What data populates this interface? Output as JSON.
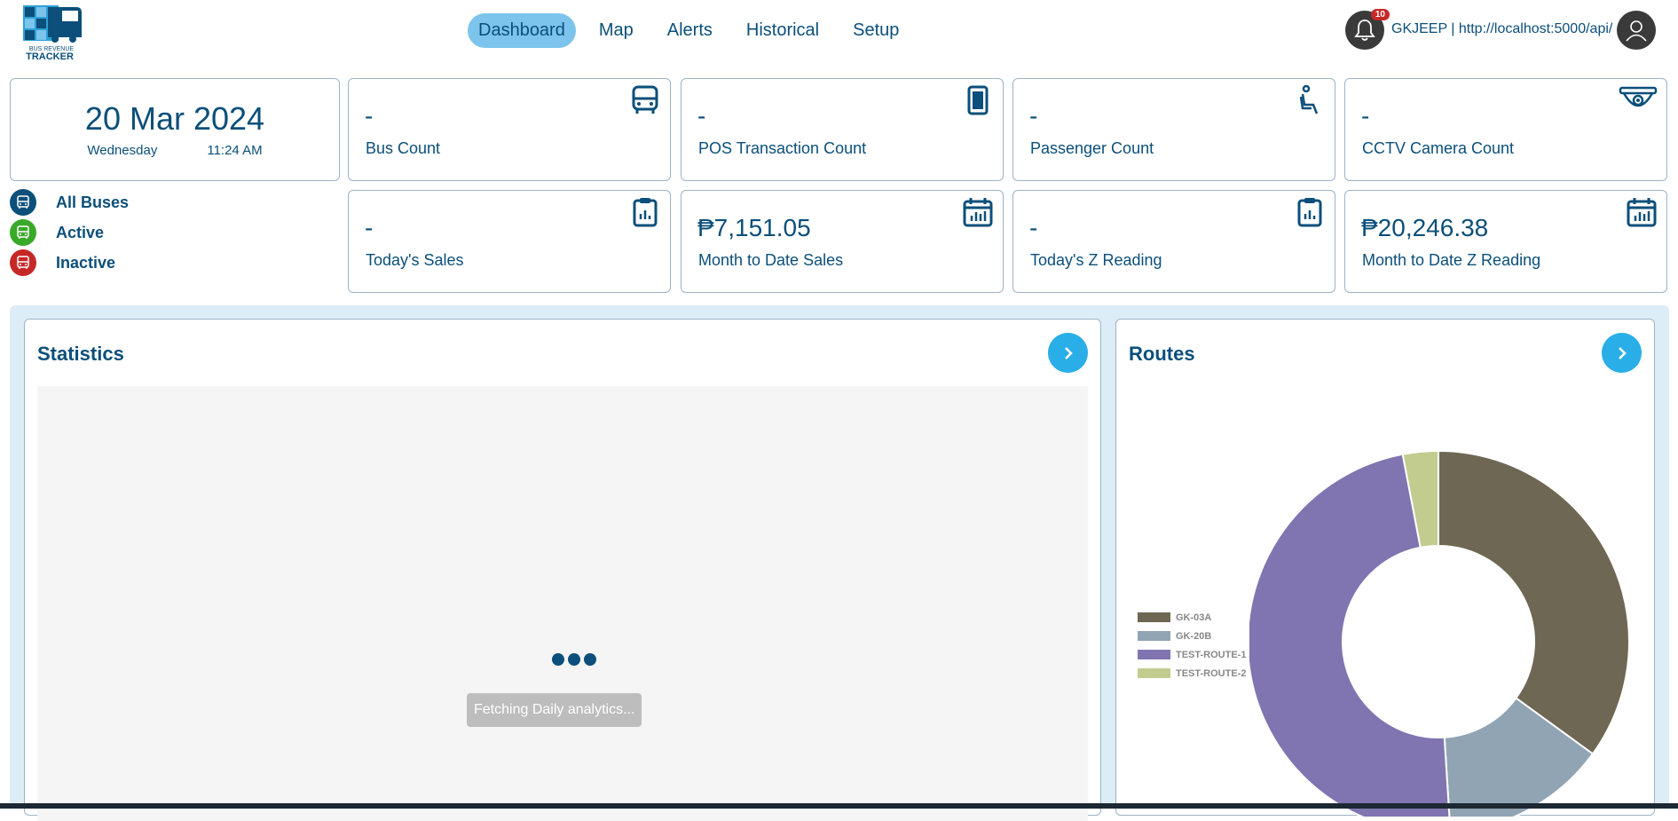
{
  "header": {
    "logo_line1": "BUS REVENUE",
    "logo_line2": "TRACKER",
    "nav": [
      {
        "label": "Dashboard",
        "active": true
      },
      {
        "label": "Map",
        "active": false
      },
      {
        "label": "Alerts",
        "active": false
      },
      {
        "label": "Historical",
        "active": false
      },
      {
        "label": "Setup",
        "active": false
      }
    ],
    "notification_count": "10",
    "user_text": "GKJEEP | http://localhost:5000/api/"
  },
  "date": {
    "main": "20 Mar 2024",
    "weekday": "Wednesday",
    "time": "11:24 AM"
  },
  "bus_status": [
    {
      "label": "All Buses",
      "color": "#0b4f7a"
    },
    {
      "label": "Active",
      "color": "#3aa829"
    },
    {
      "label": "Inactive",
      "color": "#c62828"
    }
  ],
  "stats": {
    "bus_count": {
      "value": "-",
      "label": "Bus Count",
      "icon": "bus-icon"
    },
    "pos_count": {
      "value": "-",
      "label": "POS Transaction Count",
      "icon": "pos-terminal-icon"
    },
    "passenger_count": {
      "value": "-",
      "label": "Passenger Count",
      "icon": "seated-passenger-icon"
    },
    "cctv_count": {
      "value": "-",
      "label": "CCTV Camera Count",
      "icon": "cctv-camera-icon"
    },
    "todays_sales": {
      "value": "-",
      "label": "Today's Sales",
      "icon": "clipboard-chart-icon"
    },
    "mtd_sales": {
      "value": "₱7,151.05",
      "label": "Month to Date Sales",
      "icon": "calendar-chart-icon"
    },
    "todays_z": {
      "value": "-",
      "label": "Today's Z Reading",
      "icon": "clipboard-chart-icon"
    },
    "mtd_z": {
      "value": "₱20,246.38",
      "label": "Month to Date Z Reading",
      "icon": "calendar-chart-icon"
    }
  },
  "statistics": {
    "title": "Statistics",
    "loading_text": "Fetching Daily analytics..."
  },
  "routes": {
    "title": "Routes"
  },
  "chart_data": {
    "type": "pie",
    "donut": true,
    "legend_position": "left",
    "categories": [
      "GK-03A",
      "GK-20B",
      "TEST-ROUTE-1",
      "TEST-ROUTE-2"
    ],
    "values": [
      35,
      14,
      48,
      3
    ],
    "colors": [
      "#6e6753",
      "#90a4b4",
      "#8075b1",
      "#c2cc8f"
    ]
  }
}
